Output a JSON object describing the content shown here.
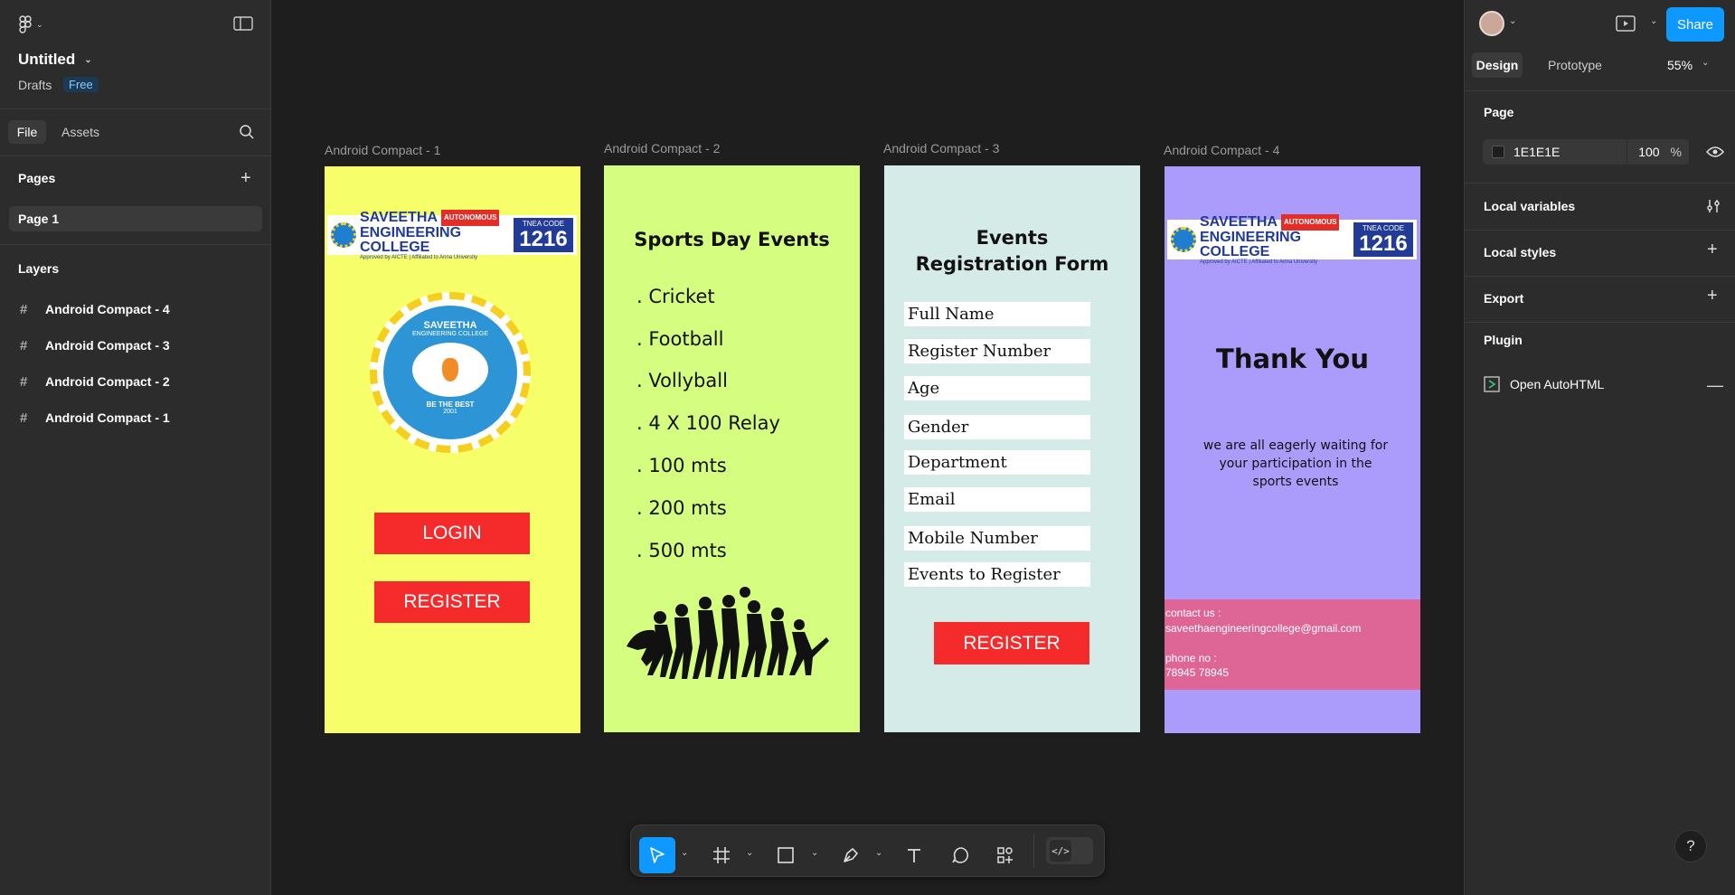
{
  "file": {
    "title": "Untitled",
    "location": "Drafts",
    "plan": "Free"
  },
  "left_tabs": [
    "File",
    "Assets"
  ],
  "pages": {
    "header": "Pages",
    "items": [
      "Page 1"
    ]
  },
  "layers": {
    "header": "Layers",
    "items": [
      "Android Compact - 4",
      "Android Compact - 3",
      "Android Compact - 2",
      "Android Compact - 1"
    ]
  },
  "frames": {
    "f1": {
      "label": "Android Compact - 1",
      "bg": "#f6fe6a",
      "login": "LOGIN",
      "register": "REGISTER",
      "logo": {
        "name1": "SAVEETHA",
        "autonomous": "AUTONOMOUS",
        "name2": "ENGINEERING COLLEGE",
        "approved": "Approved by AICTE | Affiliated to Anna University",
        "tnea": "TNEA CODE",
        "code": "1216"
      },
      "emblem": {
        "top": "SAVEETHA",
        "sub": "ENGINEERING COLLEGE",
        "motto": "BE THE BEST",
        "year": "2001"
      }
    },
    "f2": {
      "label": "Android Compact - 2",
      "bg": "#d5fe80",
      "title": "Sports Day Events",
      "items": [
        ". Cricket",
        ". Football",
        ". Vollyball",
        ". 4 X 100 Relay",
        ". 100 mts",
        ". 200 mts",
        ". 500 mts"
      ]
    },
    "f3": {
      "label": "Android Compact - 3",
      "bg": "#d5ebe7",
      "title": "Events Registration Form",
      "fields": [
        "Full Name",
        "Register Number",
        "Age",
        "Gender",
        "Department",
        "Email",
        "Mobile Number",
        "Events to Register"
      ],
      "register": "REGISTER"
    },
    "f4": {
      "label": "Android Compact - 4",
      "bg": "#ab9cfb",
      "title": "Thank You",
      "message": "we are all eagerly waiting for your participation in the sports events",
      "contact_label": "contact us :",
      "email": "saveethaengineeringcollege@gmail.com",
      "phone_label": "phone no :",
      "phone": "78945 78945",
      "band": "#dd6696"
    }
  },
  "right": {
    "tabs": [
      "Design",
      "Prototype"
    ],
    "zoom": "55%",
    "share": "Share",
    "page_section": "Page",
    "bg_hex": "1E1E1E",
    "opacity": "100",
    "opacity_unit": "%",
    "local_variables": "Local variables",
    "local_styles": "Local styles",
    "export": "Export",
    "plugin": "Plugin",
    "plugin_item": "Open AutoHTML"
  },
  "colors": {
    "accent": "#0d99ff",
    "panel": "#2c2c2c",
    "canvas": "#1e1e1e",
    "red": "#f52b2b"
  }
}
